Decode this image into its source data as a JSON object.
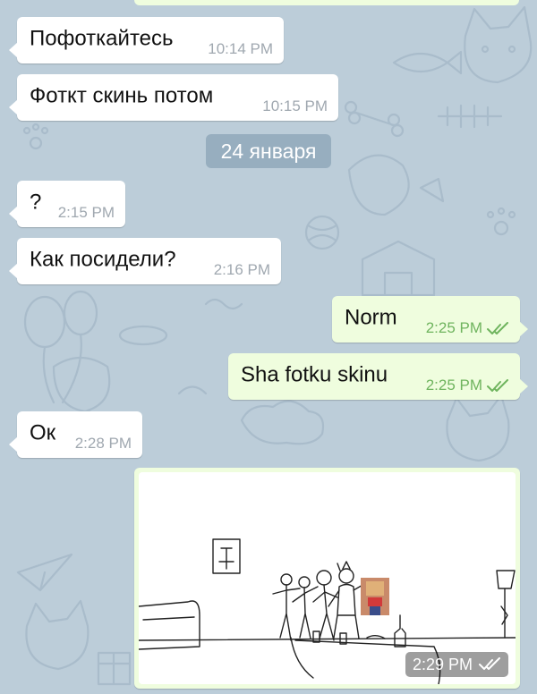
{
  "messages": [
    {
      "text": "Пофоткайтесь",
      "time": "10:14 PM"
    },
    {
      "text": "Фоткт скинь потом",
      "time": "10:15 PM"
    },
    {
      "text": "?",
      "time": "2:15 PM"
    },
    {
      "text": "Как посидели?",
      "time": "2:16 PM"
    },
    {
      "text": "Norm",
      "time": "2:25 PM"
    },
    {
      "text": "Sha fotku skinu",
      "time": "2:25 PM"
    },
    {
      "text": "Ок",
      "time": "2:28 PM"
    }
  ],
  "date_separator": "24 января",
  "photo_message": {
    "time": "2:29 PM"
  },
  "icons": {
    "read_receipt": "double-check-icon"
  },
  "colors": {
    "wallpaper": "#bccdd9",
    "incoming_bubble": "#ffffff",
    "outgoing_bubble": "#effdde",
    "outgoing_time": "#6fb45e",
    "incoming_time": "#a0a8b0"
  }
}
